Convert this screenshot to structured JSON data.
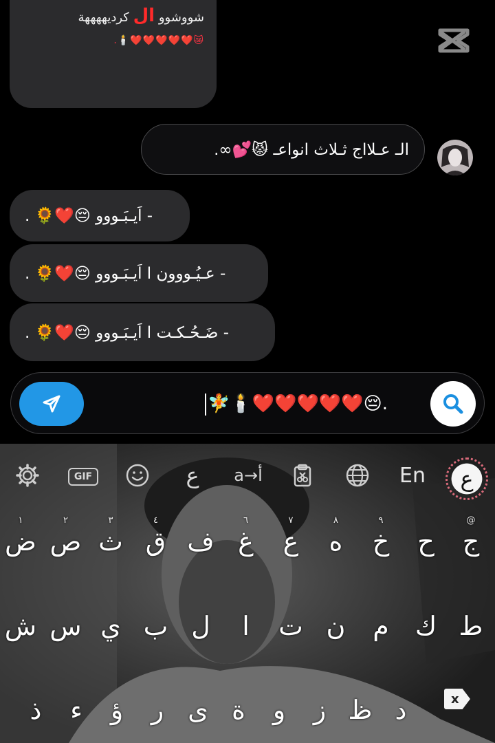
{
  "chat": {
    "top_bubble": {
      "line1_before": "شووشوو",
      "line1_red": "ال",
      "line1_after": "كرديههههة",
      "line2": ".🕯️❤️❤️❤️❤️❤️😿"
    },
    "outgoing": {
      "text": "الـ عـلااج ثـلاث انواعـ 😾💕∞."
    },
    "incoming": [
      {
        "text": "- اَيـبَـووو 😔❤️🌻 ."
      },
      {
        "text": "- عـيُـووون ا اَيـبَـووو 😔❤️🌻 ."
      },
      {
        "text": "- ضَـحُـكـت ا اَيـبَـووو 😔❤️🌻 ."
      }
    ]
  },
  "composer": {
    "input_value": "🧚🕯️❤️❤️❤️❤️❤️😔."
  },
  "keyboard": {
    "toolbar": {
      "gif_label": "GIF",
      "arabic_glyph": "ع",
      "translate_label": "a→أ",
      "en_label": "En",
      "lang_badge": "ع"
    },
    "row1": [
      {
        "hint": "@",
        "key": "ج"
      },
      {
        "hint": "",
        "key": "ح"
      },
      {
        "hint": "٩",
        "key": "خ"
      },
      {
        "hint": "٨",
        "key": "ه"
      },
      {
        "hint": "٧",
        "key": "ع"
      },
      {
        "hint": "٦",
        "key": "غ"
      },
      {
        "hint": "",
        "key": "ف"
      },
      {
        "hint": "٤",
        "key": "ق"
      },
      {
        "hint": "٣",
        "key": "ث"
      },
      {
        "hint": "٢",
        "key": "ص"
      },
      {
        "hint": "١",
        "key": "ض"
      }
    ],
    "row2": [
      {
        "hint": "",
        "key": "ط"
      },
      {
        "hint": "",
        "key": "ك"
      },
      {
        "hint": "",
        "key": "م"
      },
      {
        "hint": "",
        "key": "ن"
      },
      {
        "hint": "",
        "key": "ت"
      },
      {
        "hint": "",
        "key": "ا"
      },
      {
        "hint": "",
        "key": "ل"
      },
      {
        "hint": "",
        "key": "ب"
      },
      {
        "hint": "",
        "key": "ي"
      },
      {
        "hint": "",
        "key": "س"
      },
      {
        "hint": "",
        "key": "ش"
      }
    ],
    "row3": [
      {
        "hint": "",
        "key": "د"
      },
      {
        "hint": "",
        "key": "ظ"
      },
      {
        "hint": "",
        "key": "ز"
      },
      {
        "hint": "",
        "key": "و"
      },
      {
        "hint": "",
        "key": "ة"
      },
      {
        "hint": "",
        "key": "ى"
      },
      {
        "hint": "",
        "key": "ر"
      },
      {
        "hint": "",
        "key": "ؤ"
      },
      {
        "hint": "",
        "key": "ء"
      },
      {
        "hint": "",
        "key": "ذ"
      }
    ],
    "backspace_label": "x"
  },
  "colors": {
    "send_button": "#2297e6",
    "bubble": "#2b2b2d",
    "accent_red": "#ff2a2a"
  },
  "icons": [
    "capcut-logo-icon",
    "send-icon",
    "search-icon",
    "settings-icon",
    "gif-icon",
    "emoji-icon",
    "clipboard-icon",
    "globe-icon",
    "backspace-icon"
  ]
}
